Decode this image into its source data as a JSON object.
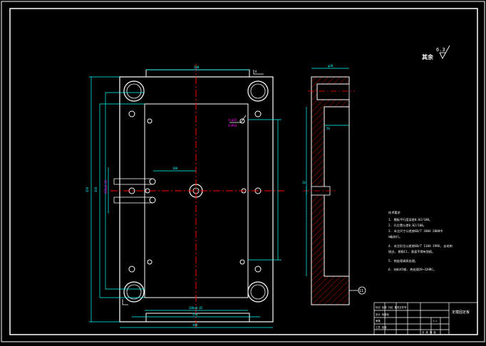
{
  "colors": {
    "background": "#000000",
    "outline": "#ffffff",
    "dimension": "#00ffff",
    "centerline": "#ff0000",
    "annotation": "#ff00ff",
    "hatch": "#ff0000",
    "notes": "#ffffff"
  },
  "roughness": {
    "value": "6.3",
    "label": "其余"
  },
  "dimensions": {
    "top_width": "200",
    "bottom_width_1": "200±0.02",
    "bottom_width_2": "250",
    "bottom_width_3": "300",
    "left_height_1": "350",
    "left_height_2": "300",
    "left_height_3": "200±0.02",
    "spacing": "100",
    "pin_note_1": "4×φ16",
    "pin_note_2": "4×M10",
    "section_top": "φ30",
    "section_mid": "50",
    "section_side": "20"
  },
  "view_labels": {
    "top_arrow": "A",
    "balloon_number": "11"
  },
  "notes": {
    "heading": "技术要求",
    "items": [
      "1. 模板平行度误差0.02/100。",
      "2. 孔位置公差0.02/100。",
      "3. 未注尺寸公差按GB/T 1804-2000中",
      "   m级执行。",
      "4. 未注形位公差按GB/T 1184-1996, 去毛刺",
      "   锐边, 倒角C1, 表面不得有划痕。",
      "5. 热处理调质处理。",
      "6. 材料45钢, 热处理28~32HRC。"
    ]
  },
  "title_block": {
    "part_name": "定模固定板",
    "rows": [
      "标记 处数 分区 更改文件号",
      "设计 标准化",
      "审核",
      "工艺 批准"
    ],
    "scale": "1:1",
    "sheet": "共 张 第 张"
  }
}
